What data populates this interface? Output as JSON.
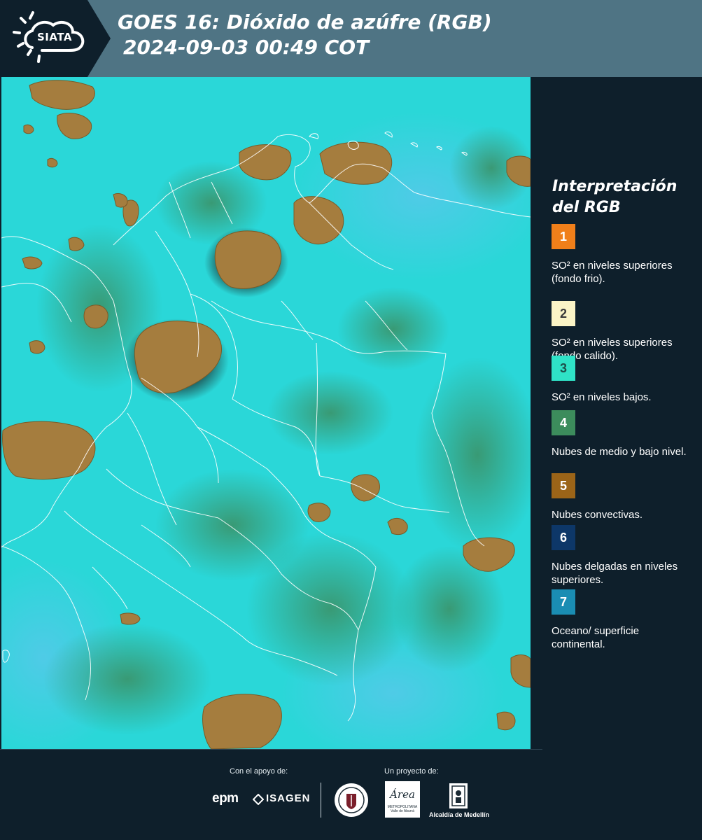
{
  "header": {
    "logo_text": "SIATA",
    "title_line1": "GOES 16: Dióxido de azúfre (RGB)",
    "title_line2": "2024-09-03 00:49 COT",
    "background_color": "#4f7484"
  },
  "legend": {
    "title": "Interpretación del RGB",
    "items": [
      {
        "number": "1",
        "color": "#f07f1a",
        "text_color": "#ffffff",
        "description": "SO² en niveles superiores (fondo frio)."
      },
      {
        "number": "2",
        "color": "#fbf4c6",
        "text_color": "#3a3a3a",
        "description": "SO² en niveles superiores (fondo calido)."
      },
      {
        "number": "3",
        "color": "#2fe3c7",
        "text_color": "#1e4f4a",
        "description": "SO² en niveles bajos."
      },
      {
        "number": "4",
        "color": "#3c8c5c",
        "text_color": "#ffffff",
        "description": "Nubes de medio y bajo nivel."
      },
      {
        "number": "5",
        "color": "#9b6418",
        "text_color": "#ffffff",
        "description": "Nubes convectivas."
      },
      {
        "number": "6",
        "color": "#0d3768",
        "text_color": "#ffffff",
        "description": "Nubes delgadas en niveles superiores."
      },
      {
        "number": "7",
        "color": "#1a8db3",
        "text_color": "#ffffff",
        "description": "Oceano/ superficie continental."
      }
    ]
  },
  "map": {
    "background_color": "#2ad7d8",
    "cloud_color": "#a57d3e",
    "border_color": "#ffffff",
    "vegetation_color": "#3e9a6a"
  },
  "footer": {
    "support_label": "Con el apoyo de:",
    "project_label": "Un proyecto de:",
    "sponsor_epm": "epm",
    "sponsor_isagen": "ISAGEN",
    "area_logo_name": "Área",
    "area_logo_sub": "METROPOLITANA Valle de Aburrá",
    "alcaldia_label": "Alcaldía de Medellín"
  }
}
